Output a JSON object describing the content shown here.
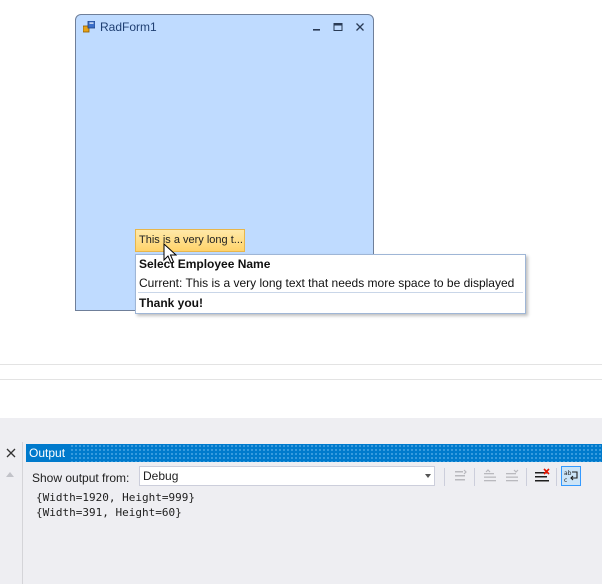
{
  "radform": {
    "title": "RadForm1",
    "icon": "radform-app-icon",
    "minimize_icon": "minimize-icon",
    "maximize_icon": "maximize-icon",
    "close_icon": "close-icon",
    "background": "#bfdbff"
  },
  "cell": {
    "text": "This is a very long t..."
  },
  "tooltip": {
    "header": "Select Employee Name",
    "body": "Current: This is a very long text that needs more space to be displayed",
    "footer": "Thank you!"
  },
  "output": {
    "title": "Output",
    "show_from_label": "Show output from:",
    "source_selected": "Debug",
    "lines": [
      "{Width=1920, Height=999}",
      "{Width=391, Height=60}"
    ],
    "toolbar_icons": [
      "find-message-in-code-icon",
      "previous-message-icon",
      "next-message-icon",
      "clear-all-icon",
      "toggle-word-wrap-icon"
    ],
    "accent": "#007acc"
  }
}
